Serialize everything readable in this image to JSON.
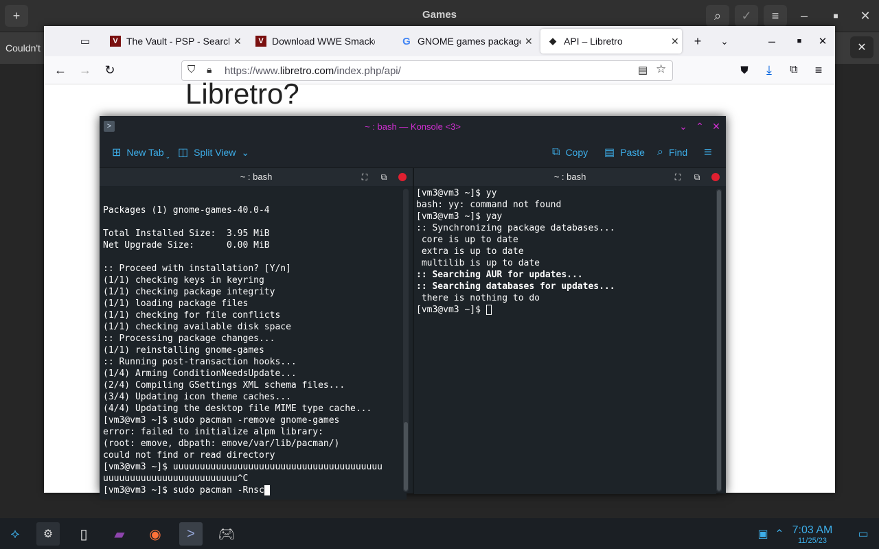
{
  "games": {
    "title": "Games",
    "infobar_text": "Couldn't"
  },
  "firefox": {
    "tabs": [
      {
        "title": "The Vault - PSP - Search",
        "favicon": "vault-favicon"
      },
      {
        "title": "Download WWE Smackdown",
        "favicon": "vault-favicon"
      },
      {
        "title": "GNOME games package",
        "favicon": "google-favicon"
      },
      {
        "title": "API – Libretro",
        "favicon": "libretro-favicon"
      }
    ],
    "url_prefix": "https://www.",
    "url_domain": "libretro.com",
    "url_path": "/index.php/api/",
    "page_heading": "Libretro?"
  },
  "konsole": {
    "window_title": "~ : bash — Konsole <3>",
    "toolbar": {
      "new_tab": "New Tab",
      "split_view": "Split View",
      "copy": "Copy",
      "paste": "Paste",
      "find": "Find"
    },
    "left_pane": {
      "title": "~ : bash",
      "lines": [
        "",
        "Packages (1) gnome-games-40.0-4",
        "",
        "Total Installed Size:  3.95 MiB",
        "Net Upgrade Size:      0.00 MiB",
        "",
        ":: Proceed with installation? [Y/n]",
        "(1/1) checking keys in keyring",
        "(1/1) checking package integrity",
        "(1/1) loading package files",
        "(1/1) checking for file conflicts",
        "(1/1) checking available disk space",
        ":: Processing package changes...",
        "(1/1) reinstalling gnome-games",
        ":: Running post-transaction hooks...",
        "(1/4) Arming ConditionNeedsUpdate...",
        "(2/4) Compiling GSettings XML schema files...",
        "(3/4) Updating icon theme caches...",
        "(4/4) Updating the desktop file MIME type cache...",
        "[vm3@vm3 ~]$ sudo pacman -remove gnome-games",
        "error: failed to initialize alpm library:",
        "(root: emove, dbpath: emove/var/lib/pacman/)",
        "could not find or read directory",
        "[vm3@vm3 ~]$ uuuuuuuuuuuuuuuuuuuuuuuuuuuuuuuuuuuuuuu",
        "uuuuuuuuuuuuuuuuuuuuuuuuu^C",
        "[vm3@vm3 ~]$ sudo pacman -Rnsc"
      ]
    },
    "right_pane": {
      "title": "~ : bash",
      "lines": [
        "[vm3@vm3 ~]$ yy",
        "bash: yy: command not found",
        "[vm3@vm3 ~]$ yay",
        ":: Synchronizing package databases...",
        " core is up to date",
        " extra is up to date",
        " multilib is up to date",
        ":: Searching AUR for updates...",
        ":: Searching databases for updates...",
        " there is nothing to do",
        "[vm3@vm3 ~]$ "
      ]
    }
  },
  "taskbar": {
    "time": "7:03 AM",
    "date": "11/25/23"
  },
  "colors": {
    "konsole_accent": "#d12fd2",
    "kde_blue": "#3daee9",
    "terminal_bg": "#1d2328"
  }
}
